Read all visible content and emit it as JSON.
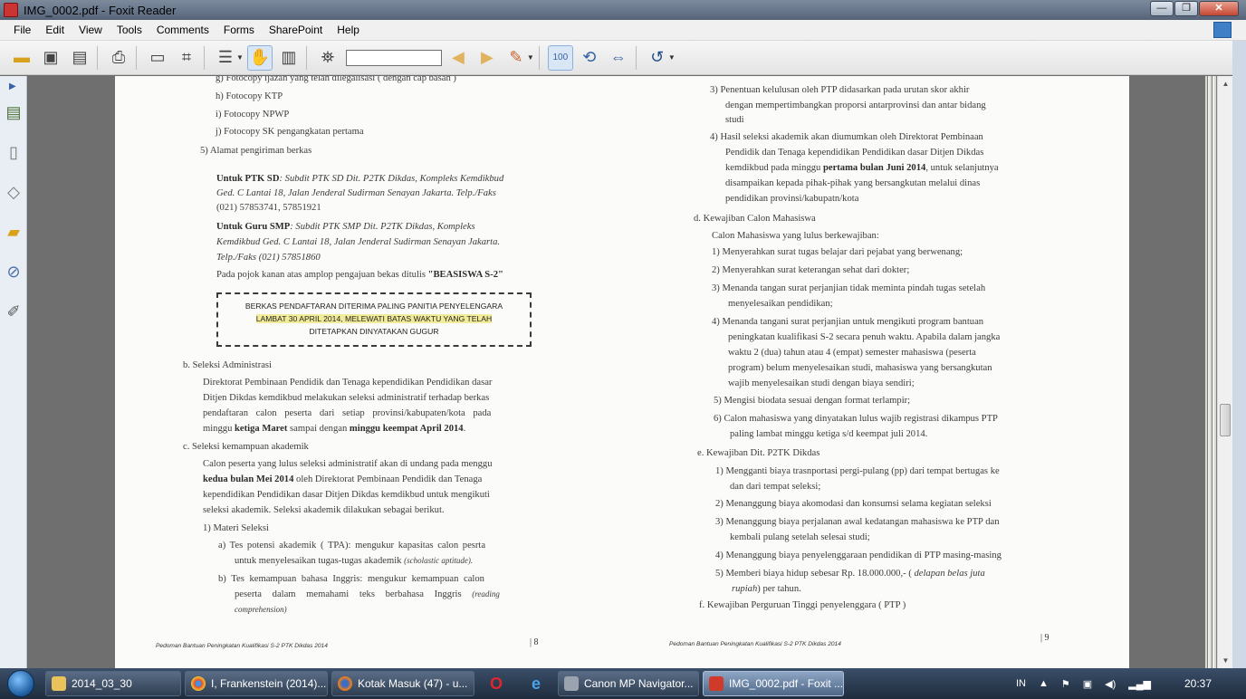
{
  "window": {
    "title": "IMG_0002.pdf - Foxit Reader"
  },
  "menu": [
    "File",
    "Edit",
    "View",
    "Tools",
    "Comments",
    "Forms",
    "SharePoint",
    "Help"
  ],
  "toolbar": {
    "search_value": ""
  },
  "page_left": {
    "lines": [
      "g)   Fotocopy ijazah yang telah dilegalisasi ( dengan cap basah )",
      "h)   Fotocopy KTP",
      "i)    Fotocopy NPWP",
      "j)    Fotocopy SK pengangkatan pertama",
      "5)   Alamat pengiriman berkas"
    ],
    "ptk_sd_label": "Untuk PTK SD",
    "ptk_sd_text_1": ": Subdit PTK SD Dit. P2TK Dikdas, Kompleks Kemdikbud",
    "ptk_sd_text_2": "Ged. C Lantai 18, Jalan Jenderal Sudirman Senayan Jakarta. Telp./Faks",
    "ptk_sd_text_3": "(021) 57853741, 57851921",
    "smp_label": "Untuk Guru SMP",
    "smp_text_1": ": Subdit PTK SMP Dit. P2TK Dikdas, Kompleks",
    "smp_text_2": "Kemdikbud Ged. C Lantai 18, Jalan Jenderal Sudirman Senayan Jakarta.",
    "smp_text_3": "Telp./Faks (021) 57851860",
    "pojok_text": "Pada pojok kanan atas amplop pengajuan bekas ditulis ",
    "pojok_bold": "\"BEASISWA S-2\"",
    "box_line_1": "BERKAS PENDAFTARAN DITERIMA PALING PANITIA PENYELENGARA",
    "box_line_2": "LAMBAT 30 APRIL 2014, MELEWATI BATAS WAKTU YANG TELAH",
    "box_line_3": "DITETAPKAN DINYATAKAN GUGUR",
    "b_heading": "b.     Seleksi Administrasi",
    "b_p1": "Direktorat Pembinaan Pendidik dan Tenaga kependidikan Pendidikan dasar",
    "b_p2": "Ditjen Dikdas kemdikbud melakukan seleksi administratif terhadap berkas",
    "b_p3": "pendaftaran calon peserta dari setiap provinsi/kabupaten/kota pada",
    "b_p4_a": "minggu ",
    "b_p4_b": "ketiga Maret",
    "b_p4_c": " sampai dengan ",
    "b_p4_d": "minggu keempat April 2014",
    "b_p4_e": ".",
    "c_heading": "c.     Seleksi kemampuan akademik",
    "c_p1": "Calon peserta yang lulus seleksi administratif akan di undang pada menggu",
    "c_p2_bold": "kedua bulan Mei 2014",
    "c_p2": " oleh Direktorat Pembinaan Pendidik dan Tenaga",
    "c_p3": "kependidikan Pendidikan dasar Ditjen Dikdas kemdikbud untuk mengikuti",
    "c_p4": "seleksi akademik. Seleksi akademik dilakukan sebagai berikut.",
    "materi": "1)   Materi Seleksi",
    "a_1": "a)   Tes potensi akademik ( TPA): mengukur kapasitas calon pesrta",
    "a_2": "untuk menyelesaikan tugas-tugas akademik ",
    "a_2_ital": "(scholastic aptitude).",
    "b_1": "b)   Tes kemampuan bahasa Inggris: mengukur kemampuan calon",
    "b_2": "peserta dalam memahami teks berbahasa Inggris ",
    "b_2_ital": "(reading",
    "b_3_ital": "comprehension)",
    "footer": "Pedoman Bantuan Peningkatan Kualifikasi S-2 PTK Dikdas 2014",
    "page_num": "| 8"
  },
  "page_right": {
    "l3_1": "3)  Penentuan kelulusan oleh PTP didasarkan pada urutan skor akhir",
    "l3_2": "dengan mempertimbangkan proporsi antarprovinsi dan antar bidang",
    "l3_3": "studi",
    "l4_1": "4)  Hasil seleksi akademik akan diumumkan oleh Direktorat Pembinaan",
    "l4_2": "Pendidik dan Tenaga kependidikan Pendidikan dasar Ditjen Dikdas",
    "l4_3a": "kemdikbud pada minggu ",
    "l4_3b": "pertama bulan Juni 2014",
    "l4_3c": ", untuk selanjutnya",
    "l4_4": "disampaikan kepada pihak-pihak yang bersangkutan melalui dinas",
    "l4_5": "pendidikan provinsi/kabupatn/kota",
    "d_heading": "d.    Kewajiban Calon Mahasiswa",
    "d_intro": "Calon Mahasiswa yang lulus berkewajiban:",
    "d1": "1)  Menyerahkan surat tugas belajar dari pejabat yang berwenang;",
    "d2": "2)  Menyerahkan surat keterangan sehat dari dokter;",
    "d3_1": "3)  Menanda tangan surat perjanjian tidak meminta pindah tugas setelah",
    "d3_2": "menyelesaikan pendidikan;",
    "d4_1": "4)  Menanda tangani surat perjanjian untuk mengikuti program bantuan",
    "d4_2": "peningkatan kualifikasi S-2 secara penuh waktu. Apabila dalam jangka",
    "d4_3": "waktu 2 (dua) tahun atau 4 (empat) semester mahasiswa (peserta",
    "d4_4": "program) belum menyelesaikan studi, mahasiswa yang bersangkutan",
    "d4_5": "wajib menyelesaikan studi dengan biaya sendiri;",
    "d5": "5)  Mengisi biodata sesuai dengan format terlampir;",
    "d6_1": "6)  Calon mahasiswa yang dinyatakan lulus wajib registrasi dikampus PTP",
    "d6_2": "paling lambat minggu ketiga s/d keempat juli 2014.",
    "e_heading": "e.    Kewajiban Dit. P2TK Dikdas",
    "e1_1": "1)  Mengganti biaya trasnportasi pergi-pulang (pp) dari tempat bertugas ke",
    "e1_2": "dan dari tempat seleksi;",
    "e2": "2)  Menanggung biaya akomodasi dan konsumsi selama kegiatan seleksi",
    "e3_1": "3)  Menanggung biaya perjalanan awal kedatangan mahasiswa ke PTP dan",
    "e3_2": "kembali pulang setelah selesai studi;",
    "e4": "4)  Menanggung biaya penyelenggaraan pendidikan di PTP masing-masing",
    "e5_1": "5)  Memberi biaya hidup sebesar Rp. 18.000.000,- ( ",
    "e5_1_ital": "delapan belas juta",
    "e5_2_ital": "rupiah",
    "e5_2": ") per tahun.",
    "f_heading": "f.    Kewajiban Perguruan Tinggi penyelenggara ( PTP )",
    "footer": "Pedoman Bantuan Peningkatan Kualifikasi S-2 PTK Dikdas 2014",
    "page_num": "| 9"
  },
  "taskbar": {
    "items": [
      "2014_03_30",
      "I, Frankenstein (2014)...",
      "Kotak Masuk (47) - u...",
      "Canon MP Navigator...",
      "IMG_0002.pdf - Foxit ..."
    ],
    "tray_lang": "IN",
    "clock": "20:37"
  },
  "colors": {
    "taskbar": "#1f2c3d",
    "page": "#fbfbf9",
    "highlight": "#f2ec9a"
  }
}
